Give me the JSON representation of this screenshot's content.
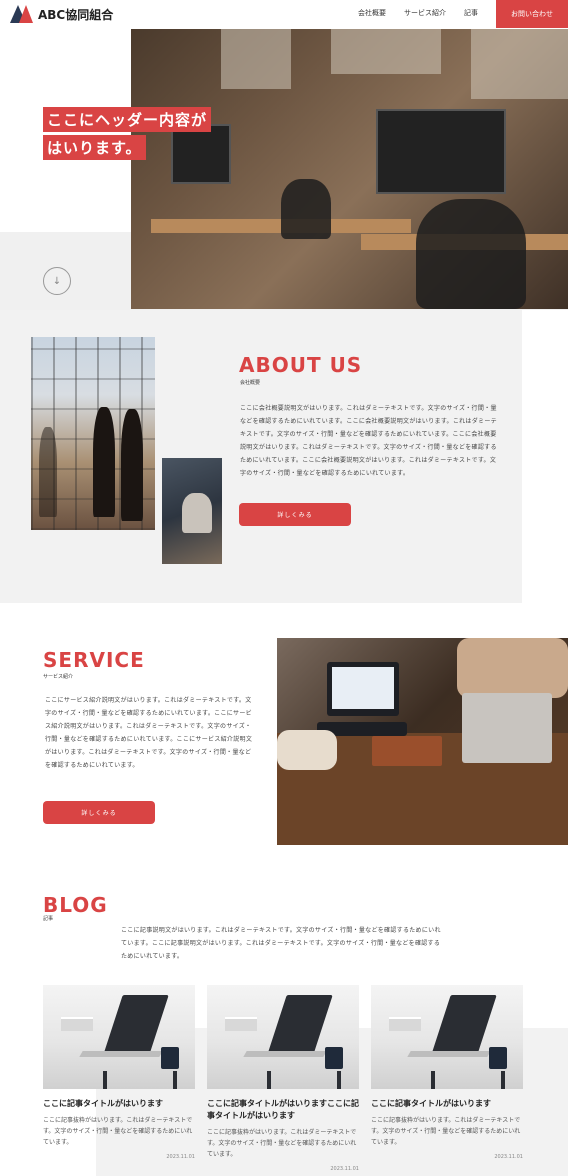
{
  "header": {
    "logo_text": "ABC協同組合",
    "nav": [
      "会社概要",
      "サービス紹介",
      "記事"
    ],
    "contact_label": "お問い合わせ"
  },
  "hero": {
    "title_line1": "ここにヘッダー内容が",
    "title_line2": "はいります。",
    "scroll_icon": "arrow-down-icon"
  },
  "about": {
    "title": "ABOUT US",
    "subtitle": "会社概要",
    "body": "ここに会社概要説明文がはいります。これはダミーテキストです。文字のサイズ・行間・量などを確認するためにいれています。ここに会社概要説明文がはいります。これはダミーテキストです。文字のサイズ・行間・量などを確認するためにいれています。ここに会社概要説明文がはいります。これはダミーテキストです。文字のサイズ・行間・量などを確認するためにいれています。ここに会社概要説明文がはいります。これはダミーテキストです。文字のサイズ・行間・量などを確認するためにいれています。",
    "button": "詳しくみる"
  },
  "service": {
    "title": "SERVICE",
    "subtitle": "サービス紹介",
    "body": "ここにサービス紹介説明文がはいります。これはダミーテキストです。文字のサイズ・行間・量などを確認するためにいれています。ここにサービス紹介説明文がはいります。これはダミーテキストです。文字のサイズ・行間・量などを確認するためにいれています。ここにサービス紹介説明文がはいります。これはダミーテキストです。文字のサイズ・行間・量などを確認するためにいれています。",
    "button": "詳しくみる"
  },
  "blog": {
    "title": "BLOG",
    "subtitle": "記事",
    "intro": "ここに記事説明文がはいります。これはダミーテキストです。文字のサイズ・行間・量などを確認するためにいれています。ここに記事説明文がはいります。これはダミーテキストです。文字のサイズ・行間・量などを確認するためにいれています。",
    "posts": [
      {
        "title": "ここに記事タイトルがはいります",
        "excerpt": "ここに記事抜粋がはいります。これはダミーテキストです。文字のサイズ・行間・量などを確認するためにいれています。",
        "date": "2023.11.01"
      },
      {
        "title": "ここに記事タイトルがはいりますここに記事タイトルがはいります",
        "excerpt": "ここに記事抜粋がはいります。これはダミーテキストです。文字のサイズ・行間・量などを確認するためにいれています。",
        "date": "2023.11.01"
      },
      {
        "title": "ここに記事タイトルがはいります",
        "excerpt": "ここに記事抜粋がはいります。これはダミーテキストです。文字のサイズ・行間・量などを確認するためにいれています。",
        "date": "2023.11.01"
      }
    ]
  },
  "colors": {
    "accent": "#d94444",
    "navy": "#2b3a55",
    "gray_bg": "#f2f2f2"
  }
}
